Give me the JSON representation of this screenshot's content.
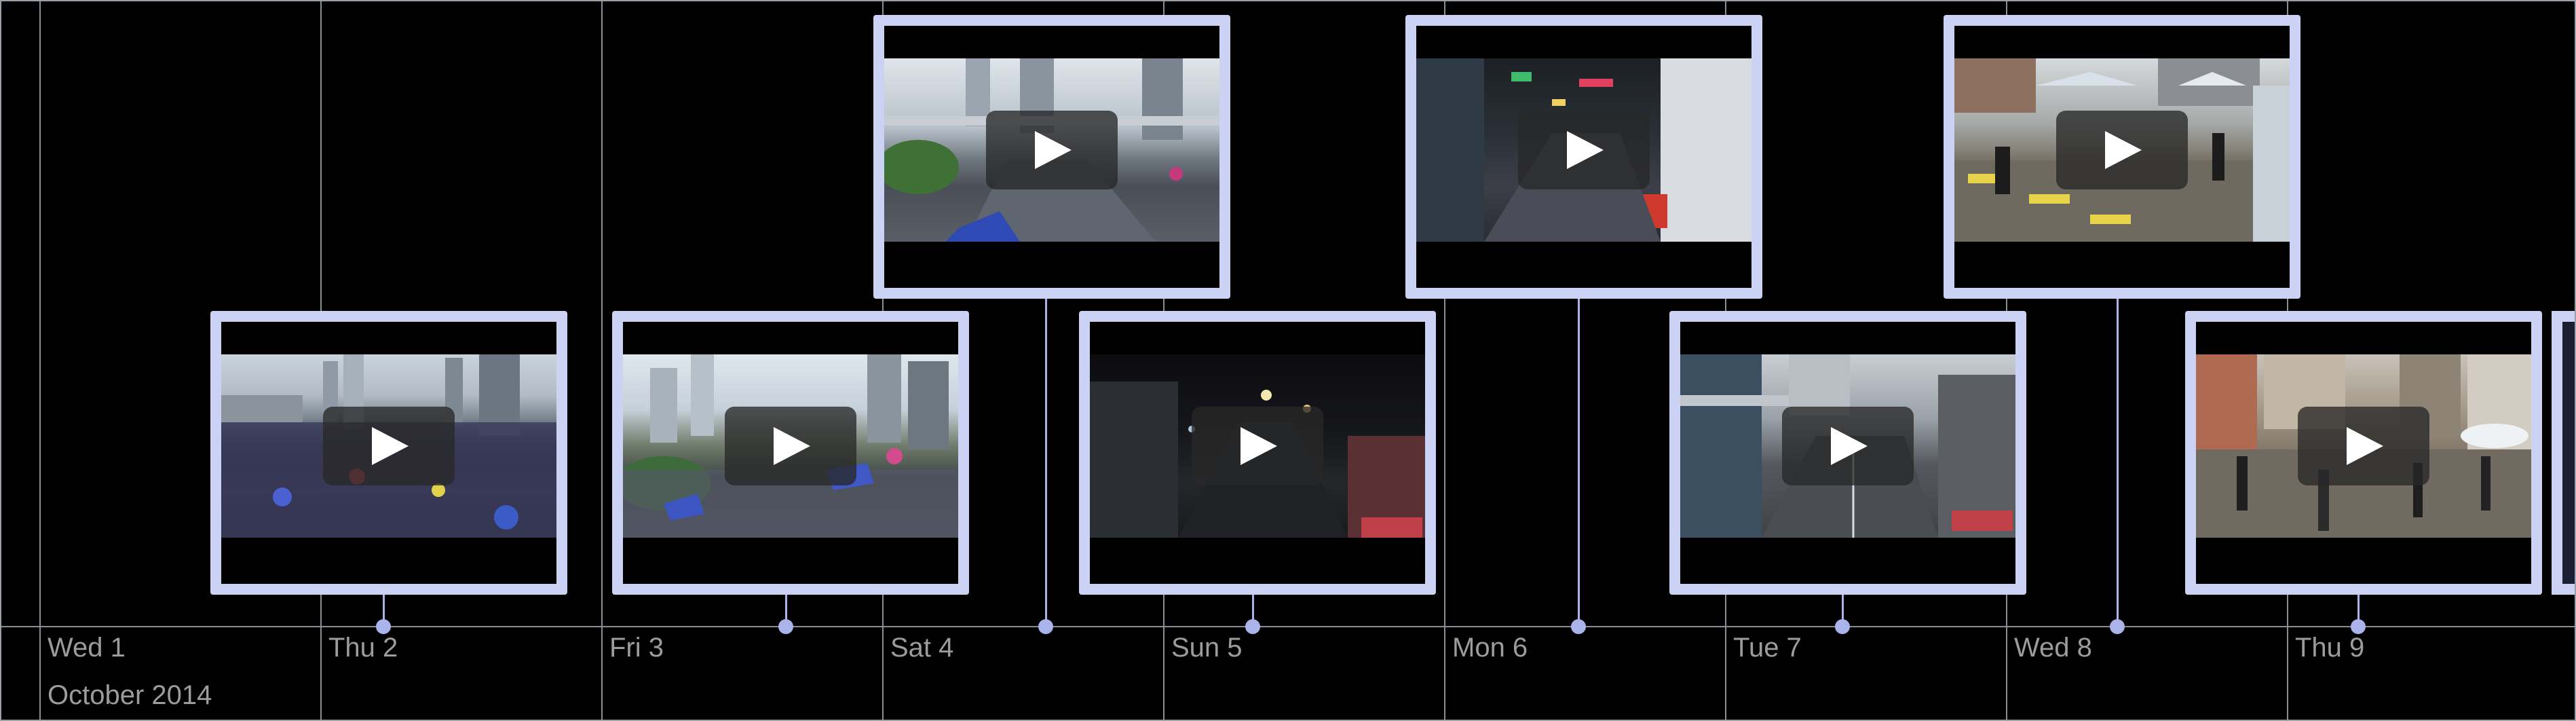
{
  "timeline": {
    "month_label": "October 2014",
    "days": [
      {
        "label": "Wed 1"
      },
      {
        "label": "Thu 2"
      },
      {
        "label": "Fri 3"
      },
      {
        "label": "Sat 4"
      },
      {
        "label": "Sun 5"
      },
      {
        "label": "Mon 6"
      },
      {
        "label": "Tue 7"
      },
      {
        "label": "Wed 8"
      },
      {
        "label": "Thu 9"
      }
    ]
  },
  "videos": [
    {
      "scene": "aerial-crowd-highway",
      "icon": "play-icon"
    },
    {
      "scene": "crowd-tents-street",
      "icon": "play-icon"
    },
    {
      "scene": "overpass-road-trees",
      "icon": "play-icon"
    },
    {
      "scene": "night-street-traffic",
      "icon": "play-icon"
    },
    {
      "scene": "night-neon-crowd",
      "icon": "play-icon"
    },
    {
      "scene": "overpass-road-day",
      "icon": "play-icon"
    },
    {
      "scene": "crosswalk-tents",
      "icon": "play-icon"
    },
    {
      "scene": "street-crowd-tents",
      "icon": "play-icon"
    }
  ],
  "colors": {
    "background": "#000000",
    "card_border": "#ccd2f4",
    "marker": "#aab3ea",
    "gridline": "#8a8f96",
    "label_text": "#9c9c9c"
  }
}
